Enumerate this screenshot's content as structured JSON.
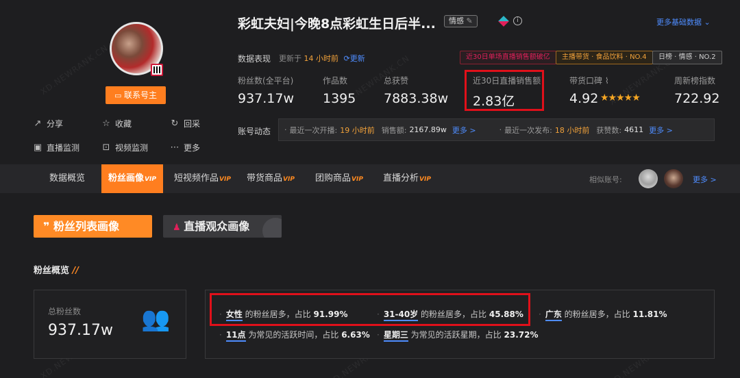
{
  "profile": {
    "title": "彩虹夫妇|今晚8点彩虹生日后半...",
    "tag": "情感",
    "more_data": "更多基础数据",
    "contact_button": "联系号主",
    "actions": [
      "分享",
      "收藏",
      "回采",
      "直播监测",
      "视频监测",
      "更多"
    ]
  },
  "performance": {
    "label": "数据表现",
    "updated_prefix": "更新于",
    "updated_time": "14 小时前",
    "refresh": "更新",
    "badges": [
      {
        "text": "近30日单场直播销售额破亿",
        "color": "#e0205a"
      },
      {
        "text": "主播带货 · 食品饮料 · NO.4",
        "color": "#f2a23a"
      },
      {
        "text": "日榜 · 情感 · NO.2",
        "color": "#d0d0d0"
      }
    ]
  },
  "metrics": [
    {
      "label": "粉丝数(全平台)",
      "value": "937.17w"
    },
    {
      "label": "作品数",
      "value": "1395"
    },
    {
      "label": "总获赞",
      "value": "7883.38w"
    },
    {
      "label": "近30日直播销售额",
      "value": "2.83亿"
    },
    {
      "label": "带货口碑",
      "value": "4.92",
      "stars": "★★★★★"
    },
    {
      "label": "周新榜指数",
      "value": "722.92"
    }
  ],
  "feed": {
    "label": "账号动态",
    "live_prefix": "最近一次开播:",
    "live_time": "19 小时前",
    "sales_label": "销售额:",
    "sales_value": "2167.89w",
    "more1": "更多 >",
    "post_prefix": "最近一次发布:",
    "post_time": "18 小时前",
    "likes_label": "获赞数:",
    "likes_value": "4611",
    "more2": "更多 >"
  },
  "nav": {
    "tabs": [
      {
        "label": "数据概览",
        "vip": ""
      },
      {
        "label": "粉丝画像",
        "vip": "VIP"
      },
      {
        "label": "短视频作品",
        "vip": "VIP"
      },
      {
        "label": "带货商品",
        "vip": "VIP"
      },
      {
        "label": "团购商品",
        "vip": "VIP"
      },
      {
        "label": "直播分析",
        "vip": "VIP"
      }
    ],
    "similar_label": "相似账号:",
    "more": "更多 >"
  },
  "portrait": {
    "fans_list_button": "粉丝列表画像",
    "live_audience_button": "直播观众画像",
    "section_title": "粉丝概览",
    "total_label": "总粉丝数",
    "total_value": "937.17w",
    "stats": [
      {
        "key": "女性",
        "text": "的粉丝居多，占比",
        "pct": "91.99%"
      },
      {
        "key": "31-40岁",
        "text": "的粉丝居多，占比",
        "pct": "45.88%"
      },
      {
        "key": "广东",
        "text": "的粉丝居多，占比",
        "pct": "11.81%"
      },
      {
        "key": "11点",
        "text": "为常见的活跃时间，占比",
        "pct": "6.63%"
      },
      {
        "key": "星期三",
        "text": "为常见的活跃星期，占比",
        "pct": "23.72%"
      }
    ]
  },
  "watermark": "XD.NEWRANK.CN"
}
